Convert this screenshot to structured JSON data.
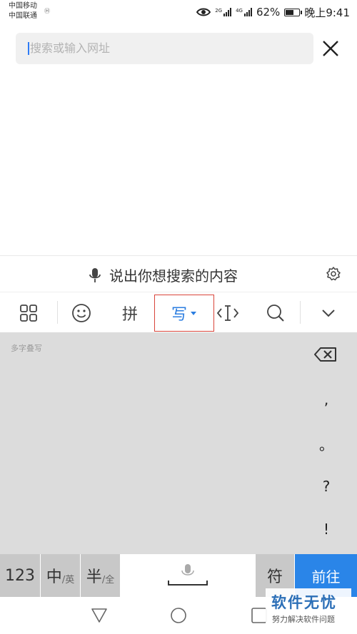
{
  "status_bar": {
    "carrier_1": "中国移动",
    "carrier_2": "中国联通",
    "hd_mark": "Ⓗ",
    "net_1": "2G",
    "net_2": "4G",
    "battery_percent": "62%",
    "battery_level": 0.62,
    "time": "晚上9:41"
  },
  "search": {
    "placeholder": "搜索或输入网址"
  },
  "voice": {
    "prompt": "说出你想搜索的内容"
  },
  "toolbar": {
    "pinyin_label": "拼",
    "write_label": "写",
    "active_tab": "write"
  },
  "handwriting": {
    "mode_label": "多字叠写",
    "punctuation": [
      ",",
      "。",
      "?",
      "!"
    ]
  },
  "keyboard": {
    "numbers_label": "123",
    "chinese_main": "中",
    "chinese_sub": "/英",
    "half_main": "半",
    "half_sub": "/全",
    "symbols_label": "符",
    "go_label": "前往"
  },
  "colors": {
    "accent_blue": "#2a85e8",
    "highlight_red": "#d9443a",
    "keyboard_grey": "#dcdcdc"
  },
  "watermark": {
    "title": "软件无忧",
    "subtitle": "努力解决软件问题"
  }
}
